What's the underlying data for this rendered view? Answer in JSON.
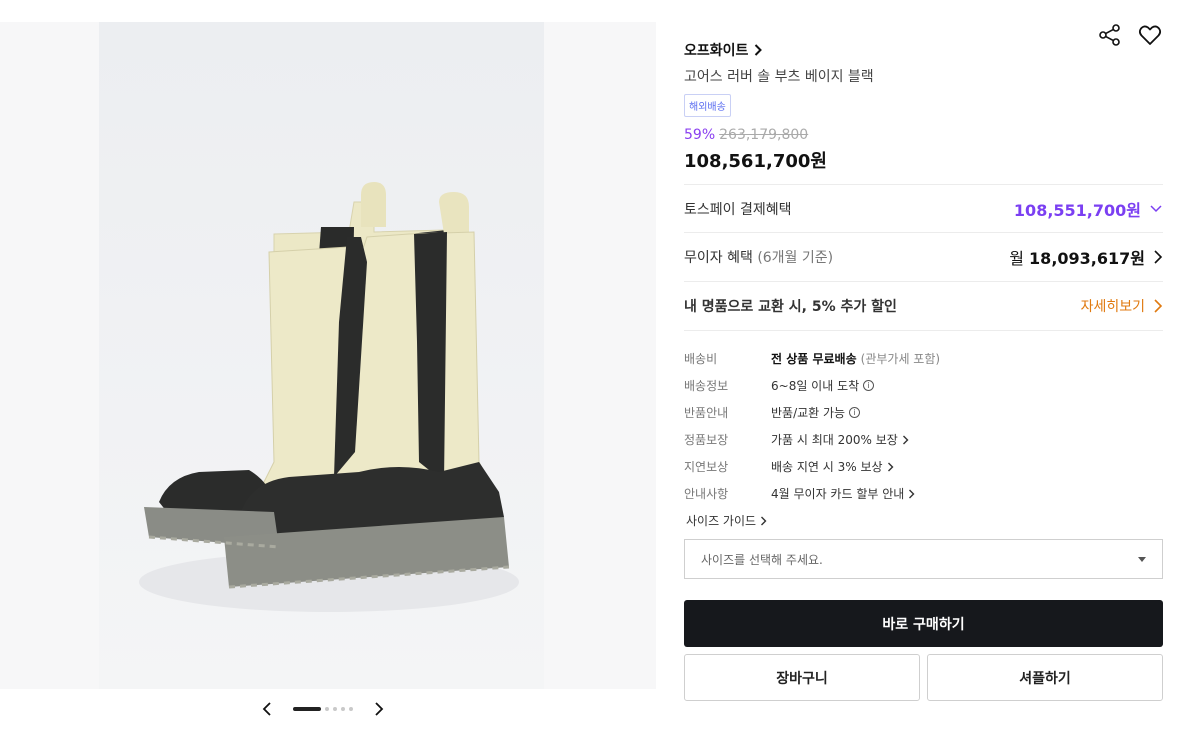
{
  "brand": {
    "name": "오프화이트"
  },
  "product": {
    "name": "고어스 러버 솔 부츠 베이지 블랙",
    "badge": "해외배송",
    "discount": "59%",
    "original_price": "263,179,800",
    "price": "108,561,700원"
  },
  "benefits": {
    "toss": {
      "label": "토스페이 결제혜택",
      "price": "108,551,700원"
    },
    "installment": {
      "label": "무이자 혜택",
      "sub": "(6개월 기준)",
      "prefix": "월",
      "amount": "18,093,617원"
    },
    "trade_in": {
      "label": "내 명품으로 교환 시, 5% 추가 할인",
      "link": "자세히보기"
    }
  },
  "details": [
    {
      "label": "배송비",
      "value_bold": "전 상품 무료배송",
      "value_muted": "(관부가세 포함)"
    },
    {
      "label": "배송정보",
      "value": "6~8일 이내 도착",
      "icon": "info-icon"
    },
    {
      "label": "반품안내",
      "value": "반품/교환 가능",
      "icon": "info-icon"
    },
    {
      "label": "정품보장",
      "value": "가품 시 최대 200% 보장",
      "icon": "chevron-right-icon"
    },
    {
      "label": "지연보상",
      "value": "배송 지연 시 3% 보상",
      "icon": "chevron-right-icon"
    },
    {
      "label": "안내사항",
      "value": "4월 무이자 카드 할부 안내",
      "icon": "chevron-right-icon"
    }
  ],
  "size_guide": "사이즈 가이드",
  "size_select": {
    "placeholder": "사이즈를 선택해 주세요."
  },
  "actions": {
    "buy": "바로 구매하기",
    "cart": "장바구니",
    "gift": "셔플하기"
  },
  "gallery": {
    "total": 5,
    "active": 0
  },
  "colors": {
    "accent_purple": "#7b3ff2",
    "orange": "#e07a10",
    "dark": "#16181c"
  }
}
